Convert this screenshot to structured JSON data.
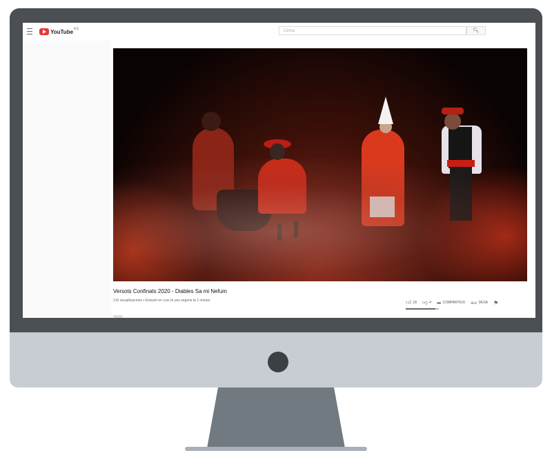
{
  "header": {
    "logo_text": "YouTube",
    "logo_region": "ES",
    "search_placeholder": "Cerca"
  },
  "video": {
    "title": "Versots Confinats 2020 - Diables Sa mi Nefum",
    "meta": "210 visualitzacions • Emissió en curs fa uns segons fa 1 minute",
    "sentiment_ratio": 0.9
  },
  "actions": {
    "likes": "18",
    "dislikes": "4",
    "share_label": "COMPARTEIX",
    "save_label": "DESA"
  },
  "icons": {
    "menu": "menu-icon",
    "search": "search-icon",
    "like": "thumb-up-icon",
    "dislike": "thumb-down-icon",
    "share": "share-icon",
    "save": "playlist-add-icon",
    "flag": "flag-icon"
  },
  "colors": {
    "brand": "#e53935",
    "monitor_frame": "#4b4e52",
    "monitor_chin": "#c8cdd3",
    "stand": "#717981"
  }
}
